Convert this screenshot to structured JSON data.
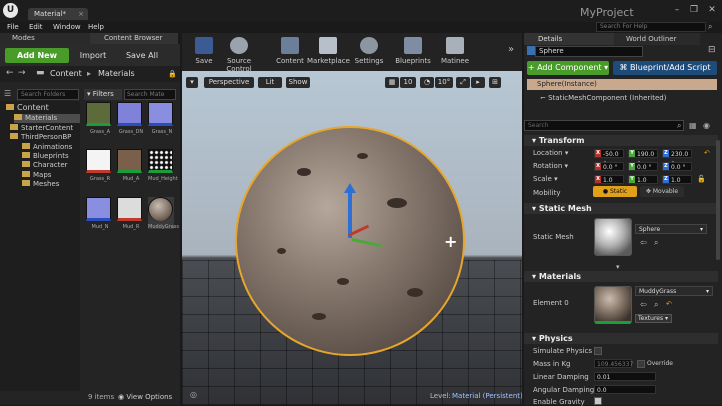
{
  "window": {
    "doc_tab": "Material*",
    "project": "MyProject"
  },
  "menu": [
    "File",
    "Edit",
    "Window",
    "Help"
  ],
  "help_search_placeholder": "Search For Help",
  "tabs": {
    "modes": "Modes",
    "content_browser": "Content Browser",
    "details": "Details",
    "world_outliner": "World Outliner"
  },
  "content_browser": {
    "add_new": "Add New",
    "import": "Import",
    "save_all": "Save All",
    "path": [
      "Content",
      "Materials"
    ],
    "search_folders": "Search Folders",
    "filters": "Filters",
    "search_assets": "Search Mate",
    "tree": [
      "Content",
      "Materials",
      "StarterContent",
      "ThirdPersonBP",
      "Animations",
      "Blueprints",
      "Character",
      "Maps",
      "Meshes"
    ],
    "assets": [
      "Grass_A",
      "Grass_DN",
      "Grass_N",
      "Grass_R",
      "Mud_A",
      "Mud_Height",
      "Mud_N",
      "Mud_R",
      "MuddyGrass"
    ],
    "items_count": "9 items",
    "view_options": "View Options"
  },
  "toolbar": [
    "Save",
    "Source Control",
    "Content",
    "Marketplace",
    "Settings",
    "Blueprints",
    "Matinee"
  ],
  "viewport": {
    "perspective": "Perspective",
    "lit": "Lit",
    "show": "Show",
    "snap_grid": "10",
    "snap_rot": "10°",
    "level_label": "Level:",
    "level_name": "Material (Persistent)"
  },
  "details": {
    "name": "Sphere",
    "add_component": "+ Add Component",
    "blueprint_script": "Blueprint/Add Script",
    "instance": "Sphere(Instance)",
    "component": "StaticMeshComponent (Inherited)",
    "search": "Search",
    "transform": {
      "title": "Transform",
      "location_label": "Location",
      "location": [
        "-50.0 c",
        "190.0 c",
        "230.0 c"
      ],
      "rotation_label": "Rotation",
      "rotation": [
        "0.0 °",
        "0.0 °",
        "0.0 °"
      ],
      "scale_label": "Scale",
      "scale": [
        "1.0",
        "1.0",
        "1.0"
      ],
      "mobility_label": "Mobility",
      "static": "Static",
      "movable": "Movable"
    },
    "static_mesh": {
      "title": "Static Mesh",
      "label": "Static Mesh",
      "value": "Sphere"
    },
    "materials": {
      "title": "Materials",
      "element_label": "Element 0",
      "value": "MuddyGrass",
      "textures": "Textures"
    },
    "physics": {
      "title": "Physics",
      "simulate": "Simulate Physics",
      "mass_label": "Mass in Kg",
      "mass": "109.456337",
      "override": "Override",
      "linear_label": "Linear Damping",
      "linear": "0.01",
      "angular_label": "Angular Damping",
      "angular": "0.0",
      "gravity": "Enable Gravity"
    }
  },
  "colors": {
    "accent_green": "#4a9c2a",
    "selection_orange": "#e7a62b",
    "blueprint_blue": "#1d4b7a"
  }
}
